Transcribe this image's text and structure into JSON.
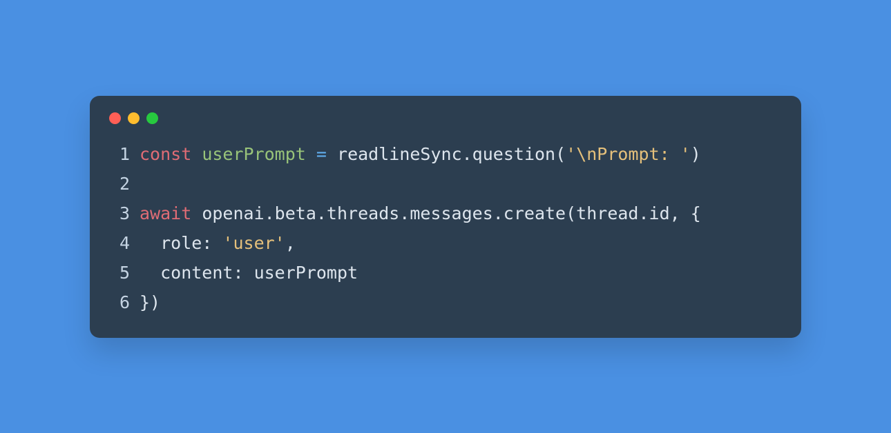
{
  "window": {
    "traffic_lights": [
      "red",
      "yellow",
      "green"
    ]
  },
  "code": {
    "lines": [
      {
        "num": "1",
        "tokens": [
          {
            "cls": "tk-keyword",
            "text": "const"
          },
          {
            "cls": "tk-plain",
            "text": " "
          },
          {
            "cls": "tk-ident-decl",
            "text": "userPrompt"
          },
          {
            "cls": "tk-plain",
            "text": " "
          },
          {
            "cls": "tk-operator",
            "text": "="
          },
          {
            "cls": "tk-plain",
            "text": " readlineSync.question("
          },
          {
            "cls": "tk-string",
            "text": "'\\nPrompt: '"
          },
          {
            "cls": "tk-plain",
            "text": ")"
          }
        ]
      },
      {
        "num": "2",
        "tokens": []
      },
      {
        "num": "3",
        "tokens": [
          {
            "cls": "tk-keyword",
            "text": "await"
          },
          {
            "cls": "tk-plain",
            "text": " openai.beta.threads.messages.create(thread.id, {"
          }
        ]
      },
      {
        "num": "4",
        "tokens": [
          {
            "cls": "tk-plain",
            "text": "  role: "
          },
          {
            "cls": "tk-string",
            "text": "'user'"
          },
          {
            "cls": "tk-plain",
            "text": ","
          }
        ]
      },
      {
        "num": "5",
        "tokens": [
          {
            "cls": "tk-plain",
            "text": "  content: userPrompt"
          }
        ]
      },
      {
        "num": "6",
        "tokens": [
          {
            "cls": "tk-plain",
            "text": "})"
          }
        ]
      }
    ]
  }
}
